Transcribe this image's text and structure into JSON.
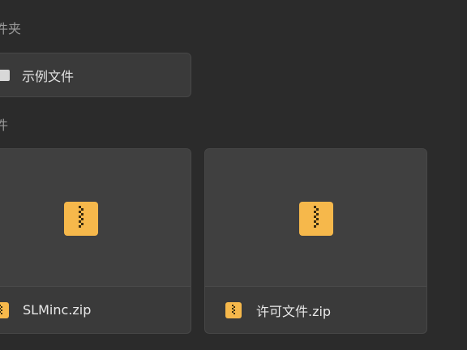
{
  "sections": {
    "folders_label": "件夹",
    "files_label": "件"
  },
  "folders": [
    {
      "name": "示例文件"
    }
  ],
  "files": [
    {
      "name": "SLMinc.zip",
      "icon": "zip-file-icon"
    },
    {
      "name": "许可文件.zip",
      "icon": "zip-file-icon"
    }
  ],
  "colors": {
    "background": "#2b2b2b",
    "card": "#3a3a3a",
    "zip_accent": "#f6b84b"
  }
}
